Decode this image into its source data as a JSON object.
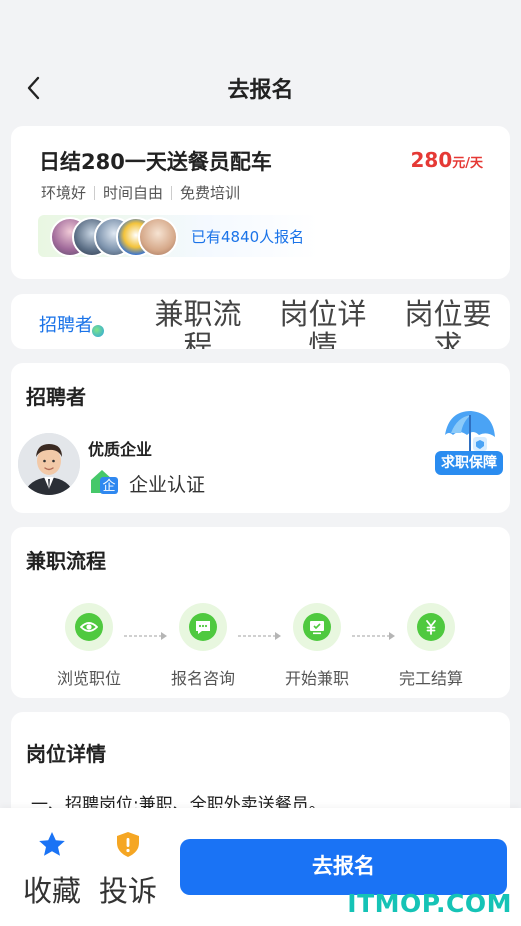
{
  "header": {
    "title": "去报名"
  },
  "job": {
    "title": "日结280一天送餐员配车",
    "salary_amount": "280",
    "salary_unit": "元/天",
    "tags": [
      "环境好",
      "时间自由",
      "免费培训"
    ],
    "applied_text": "已有4840人报名"
  },
  "tabs": {
    "items": [
      {
        "label": "招聘者"
      },
      {
        "label": "兼职流程"
      },
      {
        "label": "岗位详情"
      },
      {
        "label": "岗位要求"
      }
    ]
  },
  "recruiter": {
    "section_title": "招聘者",
    "company_name": "优质企业",
    "verify_text": "企业认证",
    "guarantee_label": "求职保障"
  },
  "flow": {
    "section_title": "兼职流程",
    "steps": [
      {
        "label": "浏览职位",
        "icon": "eye-icon"
      },
      {
        "label": "报名咨询",
        "icon": "chat-icon"
      },
      {
        "label": "开始兼职",
        "icon": "monitor-check-icon"
      },
      {
        "label": "完工结算",
        "icon": "yen-icon"
      }
    ]
  },
  "detail": {
    "section_title": "岗位详情",
    "line1": "一、招聘岗位:兼职、全职外卖送餐员。"
  },
  "bottom": {
    "favorite_label": "收藏",
    "report_label": "投诉",
    "apply_label": "去报名"
  },
  "watermark": "ITMOP.COM",
  "colors": {
    "accent": "#1a73f5",
    "price": "#e53935",
    "step_green": "#4fc93f"
  }
}
